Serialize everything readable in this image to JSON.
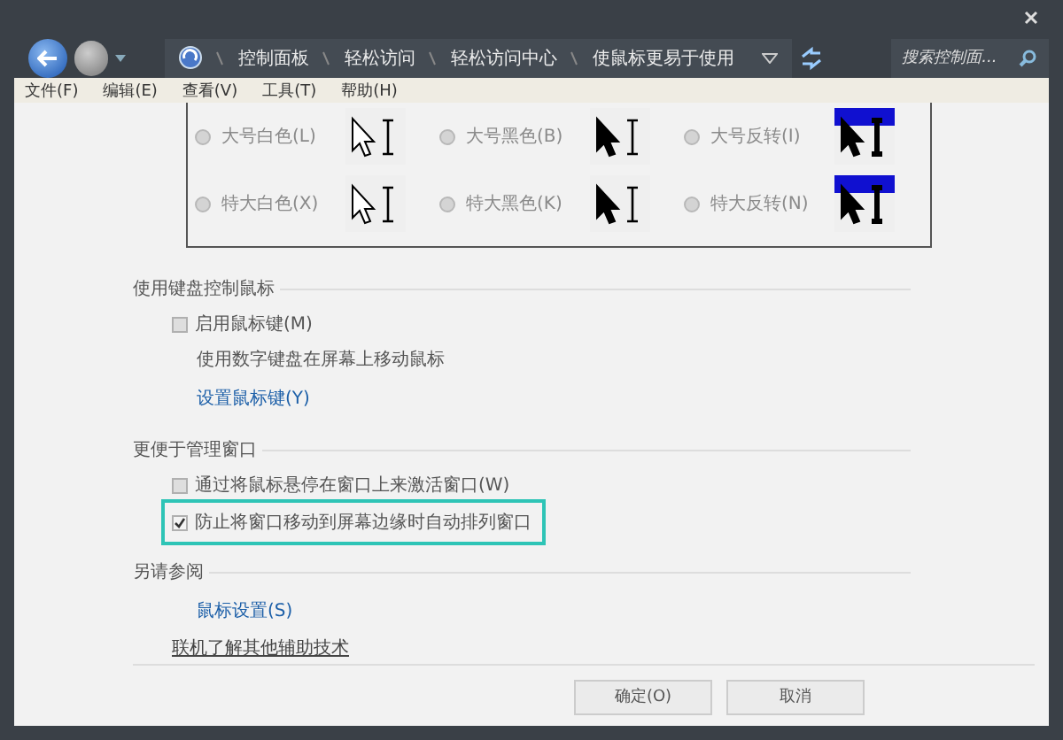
{
  "navigation": {
    "breadcrumb": [
      "控制面板",
      "轻松访问",
      "轻松访问中心",
      "使鼠标更易于使用"
    ],
    "search": {
      "placeholder": "搜索控制面..."
    }
  },
  "menu": [
    "文件(F)",
    "编辑(E)",
    "查看(V)",
    "工具(T)",
    "帮助(H)"
  ],
  "cursor_schemes": [
    {
      "label": "大号白色(L)",
      "kind": "white",
      "selected": false
    },
    {
      "label": "大号黑色(B)",
      "kind": "black",
      "selected": false
    },
    {
      "label": "大号反转(I)",
      "kind": "inverted",
      "selected": false
    },
    {
      "label": "特大白色(X)",
      "kind": "white",
      "selected": false
    },
    {
      "label": "特大黑色(K)",
      "kind": "black",
      "selected": false
    },
    {
      "label": "特大反转(N)",
      "kind": "inverted",
      "selected": false
    }
  ],
  "sections": [
    {
      "title": "使用键盘控制鼠标",
      "items": [
        {
          "kind": "checkbox",
          "label": "启用鼠标键(M)",
          "checked": false,
          "highlighted": false
        },
        {
          "kind": "note",
          "label": "使用数字键盘在屏幕上移动鼠标"
        },
        {
          "kind": "link",
          "label": "设置鼠标键(Y)"
        }
      ]
    },
    {
      "title": "更便于管理窗口",
      "items": [
        {
          "kind": "checkbox",
          "label": "通过将鼠标悬停在窗口上来激活窗口(W)",
          "checked": false,
          "highlighted": false
        },
        {
          "kind": "checkbox",
          "label": "防止将窗口移动到屏幕边缘时自动排列窗口",
          "checked": true,
          "highlighted": true
        }
      ]
    },
    {
      "title": "另请参阅",
      "items": [
        {
          "kind": "link",
          "label": "鼠标设置(S)"
        },
        {
          "kind": "underline-link",
          "label": "联机了解其他辅助技术"
        }
      ]
    }
  ],
  "buttons": [
    "确定(O)",
    "取消"
  ]
}
